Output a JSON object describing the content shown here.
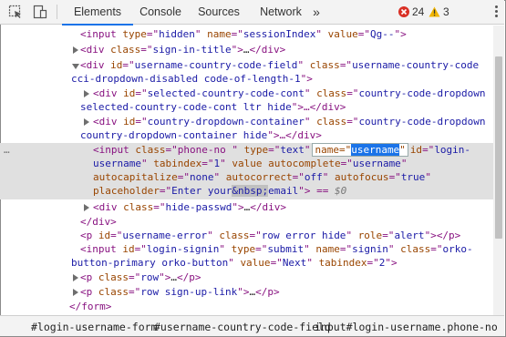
{
  "toolbar": {
    "tabs": [
      "Elements",
      "Console",
      "Sources",
      "Network"
    ],
    "more_tabs": "»",
    "errors_count": "24",
    "warnings_count": "3"
  },
  "code": {
    "l1": [
      "<input ",
      "type",
      "=\"",
      "hidden",
      "\" ",
      "name",
      "=\"",
      "sessionIndex",
      "\" ",
      "value",
      "=\"",
      "Qg--",
      "\">"
    ],
    "l2": [
      "<div ",
      "class",
      "=\"",
      "sign-in-title",
      "\">",
      "…",
      "</div>"
    ],
    "l3": [
      "<div ",
      "id",
      "=\"",
      "username-country-code-field",
      "\" ",
      "class",
      "=\"",
      "username-country-code"
    ],
    "l4": "cci-dropdown-disabled code-of-length-1",
    "l4end": "\">",
    "l5": [
      "<div ",
      "id",
      "=\"",
      "selected-country-code-cont",
      "\" ",
      "class",
      "=\"",
      "country-code-dropdown"
    ],
    "l6": "selected-country-code-cont ltr hide",
    "l6end": "\">…</div>",
    "l7": [
      "<div ",
      "id",
      "=\"",
      "country-dropdown-container",
      "\" ",
      "class",
      "=\"",
      "country-code-dropdown"
    ],
    "l8": "country-dropdown-container hide",
    "l8end": "\">…</div>",
    "l9a": [
      "<input ",
      "class",
      "=\"phone-no \" ",
      "type",
      "=\"",
      "text",
      "\""
    ],
    "l9_edit_prefix": "name=\"",
    "l9_edit_selected": "username",
    "l9_edit_suffix": "\"",
    "l9b": [
      "id",
      "=\"",
      "login-"
    ],
    "l10": [
      "username",
      "\" ",
      "tabindex",
      "=\"",
      "1",
      "\" ",
      "value ",
      "autocomplete",
      "=\"",
      "username",
      "\""
    ],
    "l11": [
      "autocapitalize",
      "=\"",
      "none",
      "\" ",
      "autocorrect",
      "=\"",
      "off",
      "\" ",
      "autofocus",
      "=\"",
      "true",
      "\""
    ],
    "l12": [
      "placeholder",
      "=\"",
      "Enter your",
      "&nbsp;",
      "email",
      "\"> == ",
      "$0"
    ],
    "l13": [
      "<div ",
      "class",
      "=\"",
      "hide-passwd",
      "\">",
      "…",
      "</div>"
    ],
    "l14": "</div>",
    "l15": [
      "<p ",
      "id",
      "=\"",
      "username-error",
      "\" ",
      "class",
      "=\"",
      "row error hide",
      "\" ",
      "role",
      "=\"",
      "alert",
      "\">",
      "</p>"
    ],
    "l16": [
      "<input ",
      "id",
      "=\"",
      "login-signin",
      "\" ",
      "type",
      "=\"",
      "submit",
      "\" ",
      "name",
      "=\"",
      "signin",
      "\" ",
      "class",
      "=\"",
      "orko-"
    ],
    "l17": [
      "button-primary orko-button",
      "\" ",
      "value",
      "=\"",
      "Next",
      "\" ",
      "tabindex",
      "=\"",
      "2",
      "\">"
    ],
    "l18": [
      "<p ",
      "class",
      "=\"",
      "row",
      "\">",
      "…",
      "</p>"
    ],
    "l19": [
      "<p ",
      "class",
      "=\"",
      "row sign-up-link",
      "\">",
      "…",
      "</p>"
    ],
    "l20": "</form>"
  },
  "breadcrumbs": [
    "#login-username-form",
    "#username-country-code-field",
    "input#login-username.phone-no"
  ]
}
